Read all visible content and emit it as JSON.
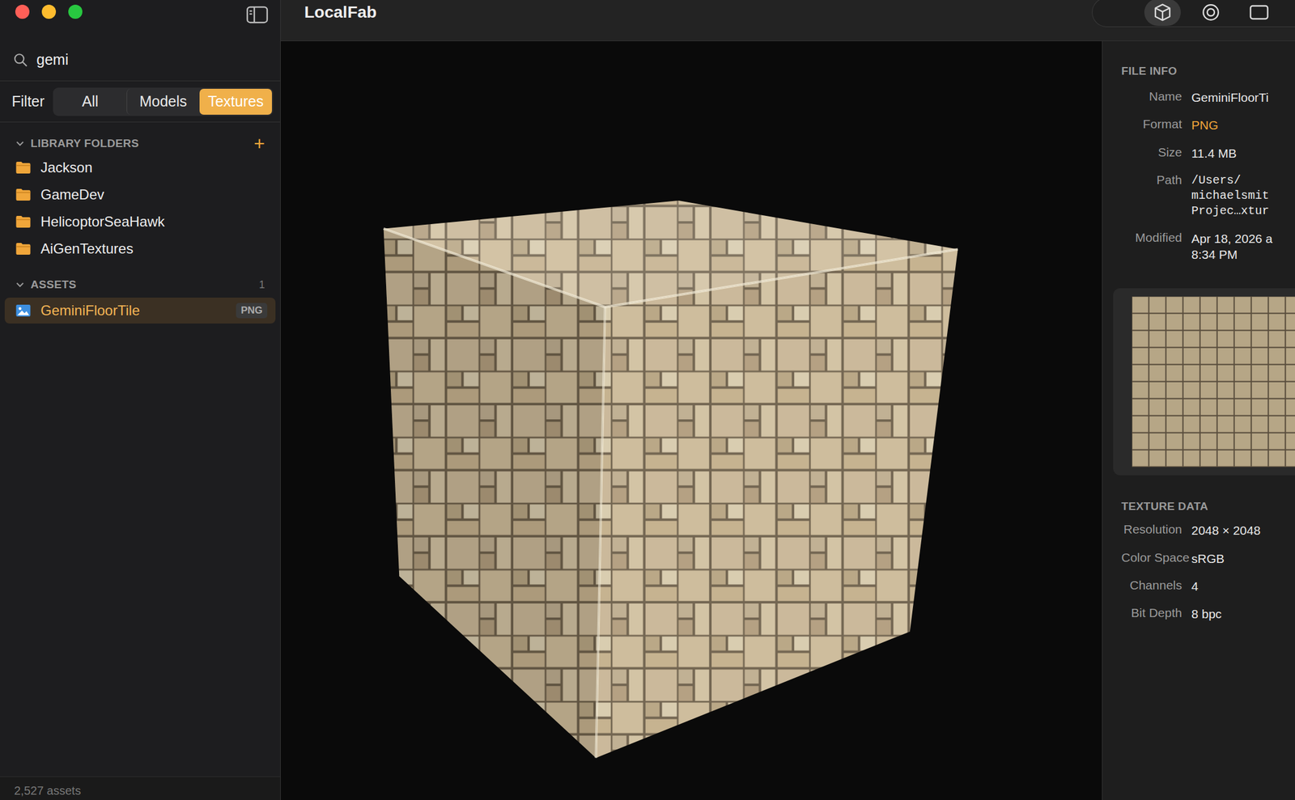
{
  "window": {
    "title": "LocalFab",
    "controls": [
      {
        "kind": "close",
        "color": "#ff5f57"
      },
      {
        "kind": "minimize",
        "color": "#febc2e"
      },
      {
        "kind": "zoom",
        "color": "#28c840"
      }
    ]
  },
  "search": {
    "value": "gemi"
  },
  "filter": {
    "label": "Filter",
    "options": [
      {
        "label": "All",
        "selected": false
      },
      {
        "label": "Models",
        "selected": false
      },
      {
        "label": "Textures",
        "selected": true
      }
    ]
  },
  "library_folders": {
    "title": "LIBRARY FOLDERS",
    "expanded": true,
    "add": "+",
    "items": [
      {
        "name": "Jackson"
      },
      {
        "name": "GameDev"
      },
      {
        "name": "HelicoptorSeaHawk"
      },
      {
        "name": "AiGenTextures"
      }
    ]
  },
  "assets": {
    "title": "ASSETS",
    "expanded": true,
    "count": "1",
    "items": [
      {
        "name": "GeminiFloorTile",
        "badge": "PNG",
        "selected": true
      }
    ]
  },
  "status_bar": {
    "text": "2,527 assets"
  },
  "view_modes": [
    {
      "kind": "cube",
      "selected": true
    },
    {
      "kind": "sphere",
      "selected": false
    },
    {
      "kind": "plane",
      "selected": false
    }
  ],
  "file_info": {
    "title": "FILE INFO",
    "fields": [
      {
        "label": "Name",
        "lines": [
          "GeminiFloorTi"
        ],
        "kind": "text"
      },
      {
        "label": "Format",
        "lines": [
          "PNG"
        ],
        "kind": "accent"
      },
      {
        "label": "Size",
        "lines": [
          "11.4 MB"
        ],
        "kind": "text"
      },
      {
        "label": "Path",
        "lines": [
          "/Users/",
          "michaelsmit",
          "Projec…xtur"
        ],
        "kind": "path"
      },
      {
        "label": "Modified",
        "lines": [
          "Apr 18, 2026 a",
          "8:34 PM"
        ],
        "kind": "text"
      }
    ]
  },
  "texture_data": {
    "title": "TEXTURE DATA",
    "fields": [
      {
        "label": "Resolution",
        "lines": [
          "2048 × 2048"
        ],
        "kind": "text"
      },
      {
        "label": "Color Space",
        "lines": [
          "sRGB"
        ],
        "kind": "text"
      },
      {
        "label": "Channels",
        "lines": [
          "4"
        ],
        "kind": "text"
      },
      {
        "label": "Bit Depth",
        "lines": [
          "8 bpc"
        ],
        "kind": "text"
      }
    ]
  }
}
